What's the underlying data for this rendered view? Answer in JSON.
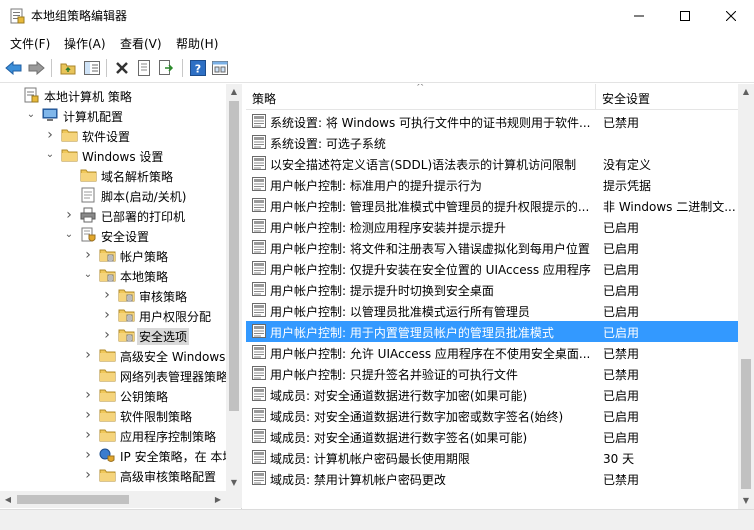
{
  "window": {
    "title": "本地组策略编辑器"
  },
  "menu": [
    "文件(F)",
    "操作(A)",
    "查看(V)",
    "帮助(H)"
  ],
  "toolbar": [
    "back-icon",
    "forward-icon",
    "up-folder-icon",
    "show-hide-tree-icon",
    "delete-icon",
    "properties-icon",
    "export-list-icon",
    "help-icon",
    "view-icon"
  ],
  "tree": [
    {
      "label": "本地计算机 策略",
      "level": 0,
      "expander": "none",
      "icon": "computer-policy-icon"
    },
    {
      "label": "计算机配置",
      "level": 1,
      "expander": "expanded",
      "icon": "computer-icon"
    },
    {
      "label": "软件设置",
      "level": 2,
      "expander": "collapsed",
      "icon": "folder-icon"
    },
    {
      "label": "Windows 设置",
      "level": 2,
      "expander": "expanded",
      "icon": "folder-icon"
    },
    {
      "label": "域名解析策略",
      "level": 3,
      "expander": "none",
      "icon": "folder-icon"
    },
    {
      "label": "脚本(启动/关机)",
      "level": 3,
      "expander": "none",
      "icon": "script-icon"
    },
    {
      "label": "已部署的打印机",
      "level": 3,
      "expander": "collapsed",
      "icon": "printer-icon"
    },
    {
      "label": "安全设置",
      "level": 3,
      "expander": "expanded",
      "icon": "security-icon"
    },
    {
      "label": "帐户策略",
      "level": 4,
      "expander": "collapsed",
      "icon": "policy-folder-icon"
    },
    {
      "label": "本地策略",
      "level": 4,
      "expander": "expanded",
      "icon": "policy-folder-icon"
    },
    {
      "label": "审核策略",
      "level": 5,
      "expander": "collapsed",
      "icon": "policy-folder-icon"
    },
    {
      "label": "用户权限分配",
      "level": 5,
      "expander": "collapsed",
      "icon": "policy-folder-icon"
    },
    {
      "label": "安全选项",
      "level": 5,
      "expander": "collapsed",
      "icon": "policy-folder-icon",
      "selected": true
    },
    {
      "label": "高级安全 Windows 防",
      "level": 4,
      "expander": "collapsed",
      "icon": "folder-icon"
    },
    {
      "label": "网络列表管理器策略",
      "level": 4,
      "expander": "none",
      "icon": "folder-icon"
    },
    {
      "label": "公钥策略",
      "level": 4,
      "expander": "collapsed",
      "icon": "folder-icon"
    },
    {
      "label": "软件限制策略",
      "level": 4,
      "expander": "collapsed",
      "icon": "folder-icon"
    },
    {
      "label": "应用程序控制策略",
      "level": 4,
      "expander": "collapsed",
      "icon": "folder-icon"
    },
    {
      "label": "IP 安全策略，在 本地计",
      "level": 4,
      "expander": "collapsed",
      "icon": "ip-security-icon"
    },
    {
      "label": "高级审核策略配置",
      "level": 4,
      "expander": "collapsed",
      "icon": "folder-icon"
    }
  ],
  "columns": {
    "policy": "策略",
    "setting": "安全设置"
  },
  "policies": [
    {
      "name": "系统设置: 将 Windows 可执行文件中的证书规则用于软件...",
      "value": "已禁用"
    },
    {
      "name": "系统设置: 可选子系统",
      "value": ""
    },
    {
      "name": "以安全描述符定义语言(SDDL)语法表示的计算机访问限制",
      "value": "没有定义"
    },
    {
      "name": "用户帐户控制: 标准用户的提升提示行为",
      "value": "提示凭据"
    },
    {
      "name": "用户帐户控制: 管理员批准模式中管理员的提升权限提示的...",
      "value": "非 Windows 二进制文..."
    },
    {
      "name": "用户帐户控制: 检测应用程序安装并提示提升",
      "value": "已启用"
    },
    {
      "name": "用户帐户控制: 将文件和注册表写入错误虚拟化到每用户位置",
      "value": "已启用"
    },
    {
      "name": "用户帐户控制: 仅提升安装在安全位置的 UIAccess 应用程序",
      "value": "已启用"
    },
    {
      "name": "用户帐户控制: 提示提升时切换到安全桌面",
      "value": "已启用"
    },
    {
      "name": "用户帐户控制: 以管理员批准模式运行所有管理员",
      "value": "已启用"
    },
    {
      "name": "用户帐户控制: 用于内置管理员帐户的管理员批准模式",
      "value": "已启用",
      "selected": true
    },
    {
      "name": "用户帐户控制: 允许 UIAccess 应用程序在不使用安全桌面...",
      "value": "已禁用"
    },
    {
      "name": "用户帐户控制: 只提升签名并验证的可执行文件",
      "value": "已禁用"
    },
    {
      "name": "域成员: 对安全通道数据进行数字加密(如果可能)",
      "value": "已启用"
    },
    {
      "name": "域成员: 对安全通道数据进行数字加密或数字签名(始终)",
      "value": "已启用"
    },
    {
      "name": "域成员: 对安全通道数据进行数字签名(如果可能)",
      "value": "已启用"
    },
    {
      "name": "域成员: 计算机帐户密码最长使用期限",
      "value": "30 天"
    },
    {
      "name": "域成员: 禁用计算机帐户密码更改",
      "value": "已禁用"
    }
  ]
}
